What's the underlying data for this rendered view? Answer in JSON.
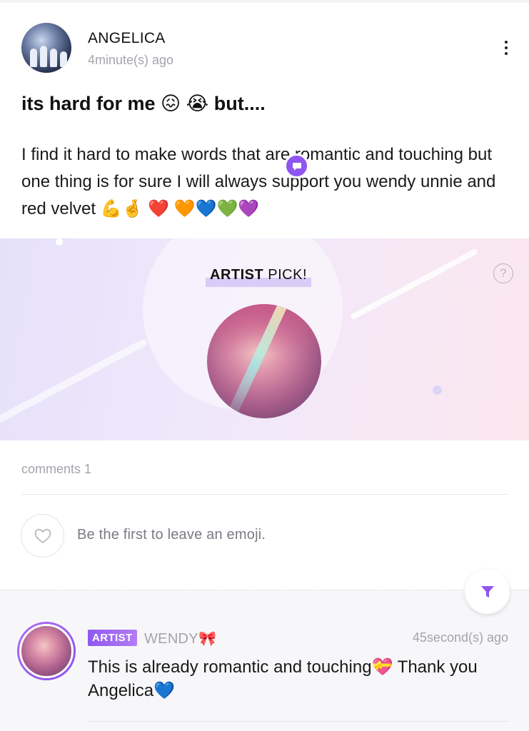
{
  "post": {
    "author": "ANGELICA",
    "timestamp": "4minute(s) ago",
    "title": "its hard for me 😖 😭 but....",
    "body": "I find it hard to make words that are romantic and touching but one thing is for sure I will always support you wendy unnie and red velvet 💪🤞 ❤️ 🧡💙💚💜",
    "more_icon": "vertical-ellipsis-icon"
  },
  "artist_pick": {
    "label_strong": "ARTIST",
    "label_rest": " PICK!",
    "help_label": "?",
    "badge_icon": "chat-bubble-icon"
  },
  "comments": {
    "count_label": "comments 1",
    "emoji_prompt": "Be the first to leave an emoji.",
    "emoji_icon": "heart-outline-icon",
    "filter_icon": "filter-icon",
    "items": [
      {
        "badge": "ARTIST",
        "name": "WENDY🎀",
        "time": "45second(s) ago",
        "text": "This is already romantic and touching💝 Thank you Angelica💙"
      }
    ]
  },
  "colors": {
    "accent_purple": "#8e55f0",
    "muted_text": "#a4a4ae",
    "banner_start": "#e6e1fb",
    "banner_end": "#fbe6ee"
  }
}
